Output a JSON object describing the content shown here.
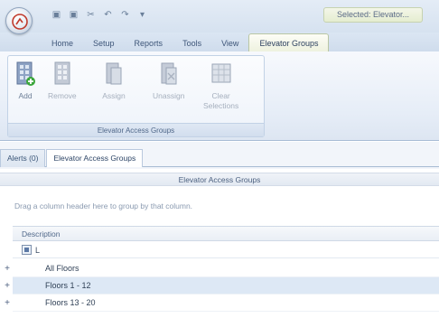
{
  "title_bar": {
    "context_title": "Selected: Elevator..."
  },
  "qat": {
    "buttons": [
      {
        "name": "save-icon",
        "glyph": "▣"
      },
      {
        "name": "save-all-icon",
        "glyph": "▣"
      },
      {
        "name": "cut-icon",
        "glyph": "✂"
      },
      {
        "name": "undo-icon",
        "glyph": "↶"
      },
      {
        "name": "redo-icon",
        "glyph": "↷"
      },
      {
        "name": "customize-icon",
        "glyph": "▾"
      }
    ]
  },
  "tabs": [
    {
      "label": "Home"
    },
    {
      "label": "Setup"
    },
    {
      "label": "Reports"
    },
    {
      "label": "Tools"
    },
    {
      "label": "View"
    },
    {
      "label": "Elevator Groups",
      "active": true
    }
  ],
  "ribbon": {
    "group_caption": "Elevator Access Groups",
    "buttons": {
      "add": "Add",
      "remove": "Remove",
      "assign": "Assign",
      "unassign": "Unassign",
      "clear": "Clear",
      "selections": "Selections"
    }
  },
  "doc_tabs": [
    {
      "label": "Alerts (0)",
      "active": false
    },
    {
      "label": "Elevator Access Groups",
      "active": true
    }
  ],
  "grid": {
    "title": "Elevator Access Groups",
    "group_hint": "Drag a column header here to group by that column.",
    "column_header": "Description",
    "filter_text": "L",
    "rows": [
      {
        "label": "All Floors",
        "selected": false
      },
      {
        "label": "Floors 1 - 12",
        "selected": true
      },
      {
        "label": "Floors 13 - 20",
        "selected": false
      }
    ]
  },
  "colors": {
    "accent": "#3d5578",
    "selection": "#dde8f5",
    "ribbon_border": "#a9bcd6"
  }
}
